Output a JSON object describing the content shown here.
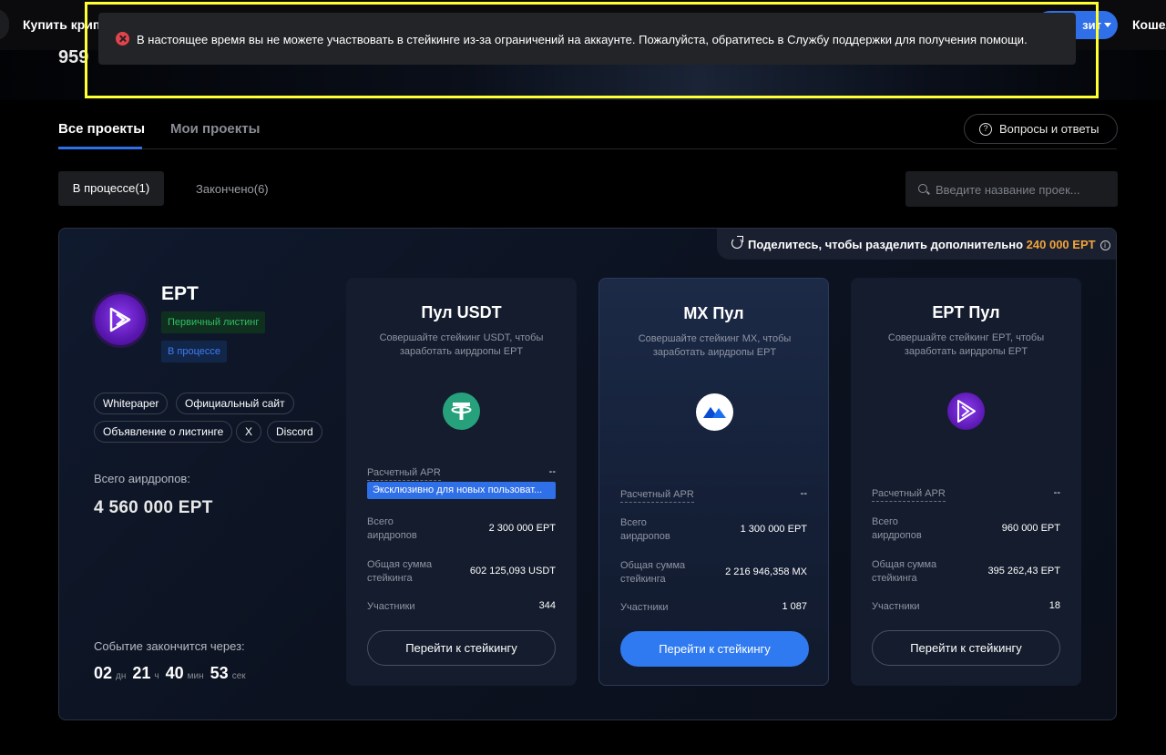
{
  "nav": {
    "buy_crypto": "Купить крипт",
    "deposit": "зит",
    "wallet": "Кошел"
  },
  "hero": {
    "number": "959"
  },
  "toast": {
    "message": "В настоящее время вы не можете участвовать в стейкинге из-за ограничений на аккаунте. Пожалуйста, обратитесь в Службу поддержки для получения помощи."
  },
  "tabs": {
    "all": "Все проекты",
    "mine": "Мои проекты"
  },
  "faq": {
    "label": "Вопросы и ответы"
  },
  "sub_tabs": {
    "in_progress": "В процессе(1)",
    "finished": "Закончено(6)"
  },
  "search": {
    "placeholder": "Введите название проек..."
  },
  "share": {
    "text": "Поделитесь, чтобы разделить дополнительно",
    "amount": "240 000 EPT"
  },
  "project": {
    "name": "EPT",
    "badge_primary": "Первичный листинг",
    "badge_status": "В процессе",
    "links": [
      "Whitepaper",
      "Официальный сайт",
      "Объявление о листинге",
      "X",
      "Discord"
    ],
    "total_label": "Всего аирдропов:",
    "total_value": "4 560 000 EPT",
    "ends_label": "Событие закончится через:",
    "countdown": {
      "days": "02",
      "days_u": "дн",
      "hours": "21",
      "hours_u": "ч",
      "mins": "40",
      "mins_u": "мин",
      "secs": "53",
      "secs_u": "сек"
    }
  },
  "labels": {
    "apr": "Расчетный APR",
    "airdrops": "Всего аирдропов",
    "total_staked": "Общая сумма стейкинга",
    "participants": "Участники",
    "button": "Перейти к стейкингу"
  },
  "pools": [
    {
      "title": "Пул USDT",
      "desc": "Совершайте стейкинг USDT, чтобы заработать аирдропы EPT",
      "apr": "--",
      "exclusive": "Эксклюзивно для новых пользоват...",
      "airdrops": "2 300 000 EPT",
      "staked": "602 125,093 USDT",
      "participants": "344",
      "coin": "usdt-icon",
      "color": "#26a17b"
    },
    {
      "title": "MX Пул",
      "desc": "Совершайте стейкинг MX, чтобы заработать аирдропы EPT",
      "apr": "--",
      "airdrops": "1 300 000 EPT",
      "staked": "2 216 946,358 MX",
      "participants": "1 087",
      "coin": "mx-icon",
      "color": "#ffffff"
    },
    {
      "title": "EPT Пул",
      "desc": "Совершайте стейкинг EPT, чтобы заработать аирдропы EPT",
      "apr": "--",
      "airdrops": "960 000 EPT",
      "staked": "395 262,43 EPT",
      "participants": "18",
      "coin": "ept-icon",
      "color": "#6a22c8"
    }
  ]
}
